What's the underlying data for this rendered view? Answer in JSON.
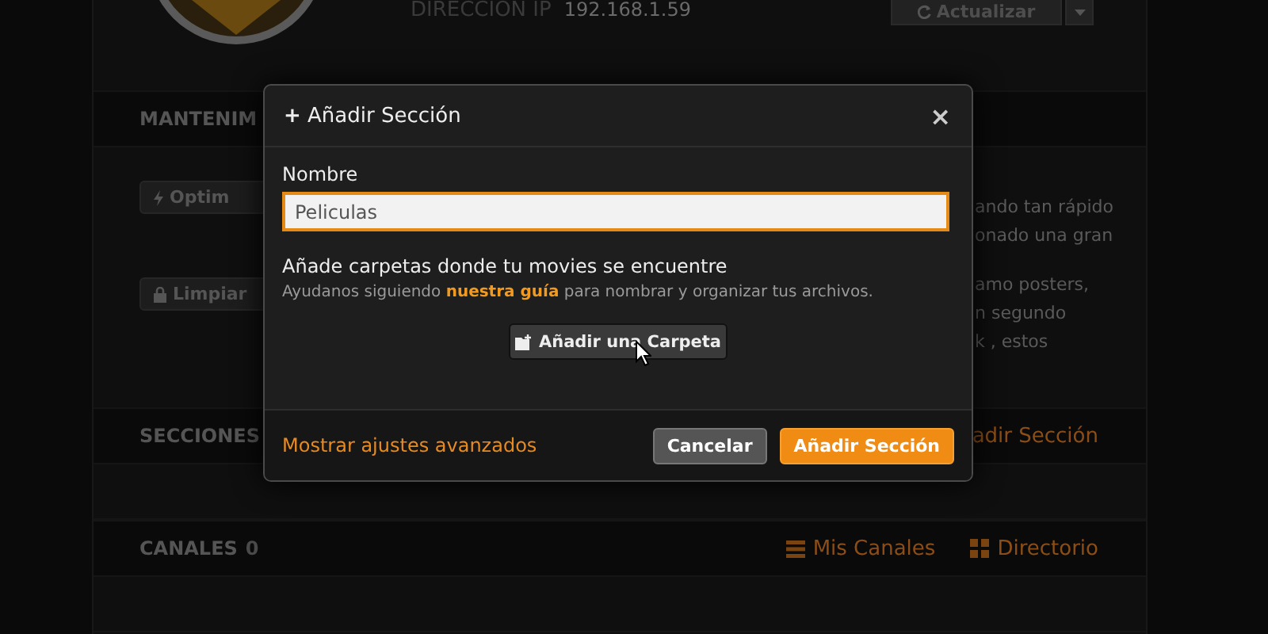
{
  "server": {
    "ip_label": "DIRECCION IP",
    "ip": "192.168.1.59",
    "refresh_button": "Actualizar"
  },
  "maintenance": {
    "title": "MANTENIM",
    "buttons": [
      {
        "label": "Optim",
        "kind": "bolt"
      },
      {
        "label": "Limpiar",
        "kind": "lock"
      }
    ],
    "text_lines": [
      [
        "ando tan rápido",
        "onado una gran"
      ],
      [
        "amo posters,",
        "n segundo",
        "k , estos"
      ]
    ]
  },
  "sections": {
    "title": "SECCIONES",
    "add_link": "adir Sección"
  },
  "channels": {
    "title": "CANALES",
    "count": "0",
    "links": [
      {
        "label": "Mis Canales",
        "kind": "list"
      },
      {
        "label": "Directorio",
        "kind": "grid"
      }
    ]
  },
  "dialog": {
    "title": "Añadir Sección",
    "title_icon": "+",
    "close": "×",
    "name_label": "Nombre",
    "name_value": "Peliculas",
    "folders_heading": "Añade carpetas donde tu movies se encuentre",
    "help": "Ayudanos siguiendo **nuestra guía** para nombrar y organizar tus archivos.",
    "add_folder_button": "Añadir una Carpeta",
    "advanced_link": "Mostrar ajustes avanzados",
    "buttons": [
      {
        "label": "Cancelar",
        "kind": "secondary"
      },
      {
        "label": "Añadir Sección",
        "kind": "primary"
      }
    ]
  }
}
